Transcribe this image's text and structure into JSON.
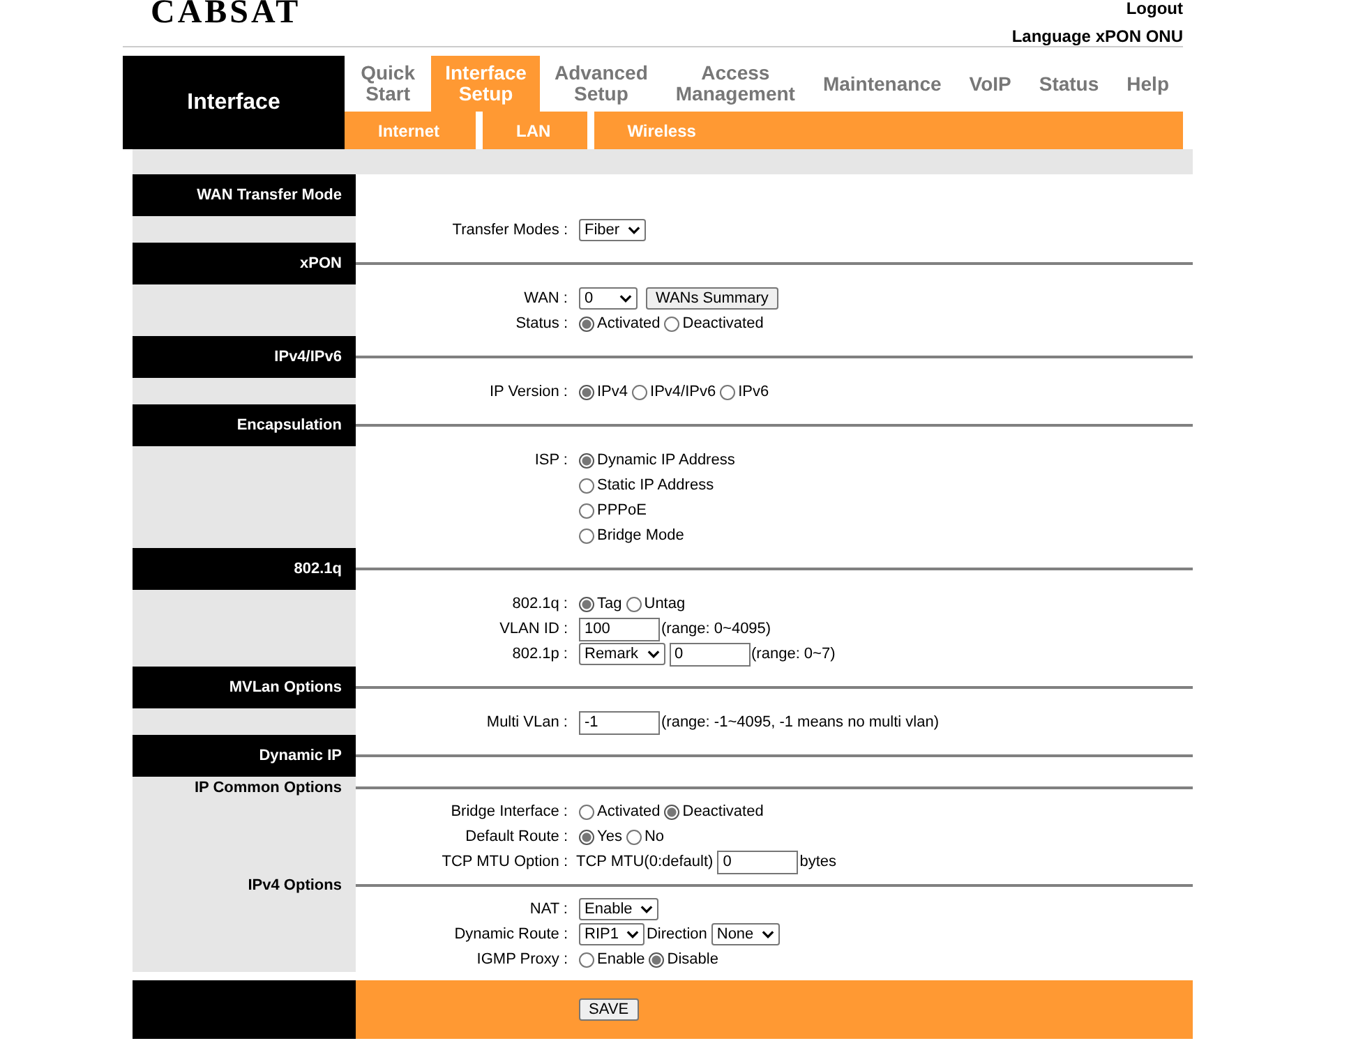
{
  "header": {
    "logo": "CABSAT",
    "logout": "Logout",
    "language": "Language xPON ONU"
  },
  "nav": {
    "section_title": "Interface",
    "tabs": [
      {
        "label": "Quick Start",
        "selected": false
      },
      {
        "label": "Interface Setup",
        "selected": true
      },
      {
        "label": "Advanced Setup",
        "selected": false
      },
      {
        "label": "Access Management",
        "selected": false
      },
      {
        "label": "Maintenance",
        "selected": false
      },
      {
        "label": "VoIP",
        "selected": false
      },
      {
        "label": "Status",
        "selected": false
      },
      {
        "label": "Help",
        "selected": false
      }
    ],
    "subtabs": [
      {
        "label": "Internet"
      },
      {
        "label": "LAN"
      },
      {
        "label": "Wireless"
      }
    ]
  },
  "sections": [
    {
      "kind": "header",
      "title": "WAN Transfer Mode",
      "rule": false,
      "rows": [
        {
          "label": "Transfer Modes :",
          "controls": [
            {
              "kind": "select",
              "value": "Fiber"
            }
          ]
        }
      ]
    },
    {
      "kind": "header",
      "title": "xPON",
      "rule": true,
      "rows": [
        {
          "label": "WAN :",
          "controls": [
            {
              "kind": "select",
              "value": "0"
            },
            {
              "kind": "button",
              "label": "WANs Summary"
            }
          ]
        },
        {
          "label": "Status :",
          "controls": [
            {
              "kind": "radio",
              "label": "Activated",
              "selected": true
            },
            {
              "kind": "radio",
              "label": "Deactivated",
              "selected": false
            }
          ]
        }
      ]
    },
    {
      "kind": "header",
      "title": "IPv4/IPv6",
      "rule": true,
      "rows": [
        {
          "label": "IP Version :",
          "controls": [
            {
              "kind": "radio",
              "label": "IPv4",
              "selected": true
            },
            {
              "kind": "radio",
              "label": "IPv4/IPv6",
              "selected": false
            },
            {
              "kind": "radio",
              "label": "IPv6",
              "selected": false
            }
          ]
        }
      ]
    },
    {
      "kind": "header",
      "title": "Encapsulation",
      "rule": true,
      "rows": [
        {
          "label": "ISP :",
          "stacked": true,
          "controls": [
            {
              "kind": "radio",
              "label": "Dynamic IP Address",
              "selected": true
            },
            {
              "kind": "radio",
              "label": "Static IP Address",
              "selected": false
            },
            {
              "kind": "radio",
              "label": "PPPoE",
              "selected": false
            },
            {
              "kind": "radio",
              "label": "Bridge Mode",
              "selected": false
            }
          ]
        }
      ]
    },
    {
      "kind": "header",
      "title": "802.1q",
      "rule": true,
      "rows": [
        {
          "label": "802.1q :",
          "controls": [
            {
              "kind": "radio",
              "label": "Tag",
              "selected": true
            },
            {
              "kind": "radio",
              "label": "Untag",
              "selected": false
            }
          ]
        },
        {
          "label": "VLAN ID :",
          "controls": [
            {
              "kind": "input",
              "value": "100"
            },
            {
              "kind": "text",
              "text": "(range: 0~4095)"
            }
          ]
        },
        {
          "label": "802.1p :",
          "controls": [
            {
              "kind": "select",
              "value": "Remark"
            },
            {
              "kind": "input",
              "value": "0"
            },
            {
              "kind": "text",
              "text": "(range: 0~7)"
            }
          ]
        }
      ]
    },
    {
      "kind": "header",
      "title": "MVLan Options",
      "rule": true,
      "rows": [
        {
          "label": "Multi VLan :",
          "controls": [
            {
              "kind": "input",
              "value": "-1"
            },
            {
              "kind": "text",
              "text": "(range: -1~4095, -1 means no multi vlan)"
            }
          ]
        }
      ]
    },
    {
      "kind": "header",
      "title": "Dynamic IP",
      "rule": true
    },
    {
      "kind": "subheader",
      "title": "IP Common Options",
      "rule": true,
      "rows": [
        {
          "label": "Bridge Interface :",
          "controls": [
            {
              "kind": "radio",
              "label": "Activated",
              "selected": false
            },
            {
              "kind": "radio",
              "label": "Deactivated",
              "selected": true
            }
          ]
        },
        {
          "label": "Default Route :",
          "controls": [
            {
              "kind": "radio",
              "label": "Yes",
              "selected": true
            },
            {
              "kind": "radio",
              "label": "No",
              "selected": false
            }
          ]
        },
        {
          "label": "TCP MTU Option :",
          "controls": [
            {
              "kind": "text",
              "text": "TCP MTU(0:default)"
            },
            {
              "kind": "input",
              "value": "0"
            },
            {
              "kind": "text",
              "text": "bytes"
            }
          ]
        }
      ]
    },
    {
      "kind": "subheader",
      "title": "IPv4 Options",
      "rule": true,
      "rows": [
        {
          "label": "NAT :",
          "controls": [
            {
              "kind": "select",
              "value": "Enable"
            }
          ]
        },
        {
          "label": "Dynamic Route :",
          "controls": [
            {
              "kind": "select",
              "value": "RIP1"
            },
            {
              "kind": "text",
              "text": "Direction"
            },
            {
              "kind": "select",
              "value": "None"
            }
          ]
        },
        {
          "label": "IGMP Proxy :",
          "controls": [
            {
              "kind": "radio",
              "label": "Enable",
              "selected": false
            },
            {
              "kind": "radio",
              "label": "Disable",
              "selected": true
            }
          ]
        }
      ]
    }
  ],
  "save_button": "SAVE"
}
